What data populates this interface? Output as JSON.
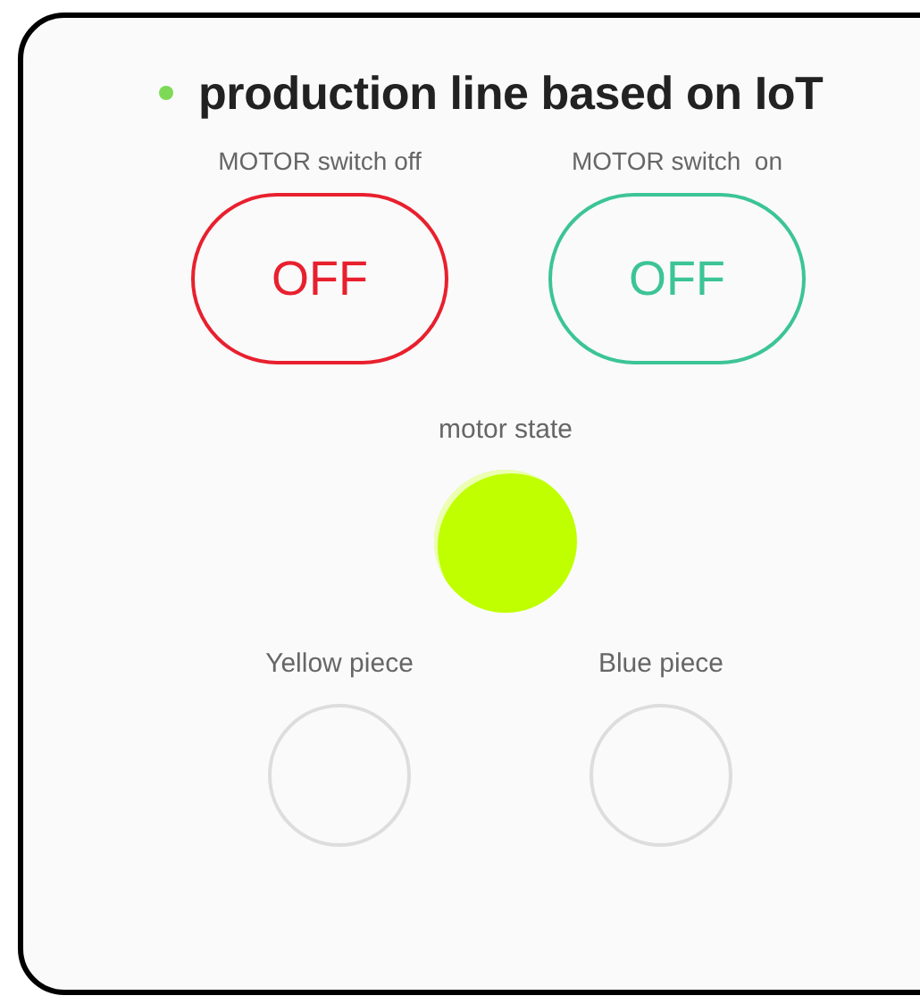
{
  "title": {
    "text": "production line based on IoT"
  },
  "switches": [
    {
      "label": "MOTOR switch off",
      "text": "OFF",
      "color": "#e8202e"
    },
    {
      "label": "MOTOR switch  on",
      "text": "OFF",
      "color": "#3cc497"
    }
  ],
  "motor_state": {
    "label": "motor state",
    "on": true
  },
  "pieces": [
    {
      "label": "Yellow piece",
      "on": false
    },
    {
      "label": "Blue piece",
      "on": false
    }
  ]
}
